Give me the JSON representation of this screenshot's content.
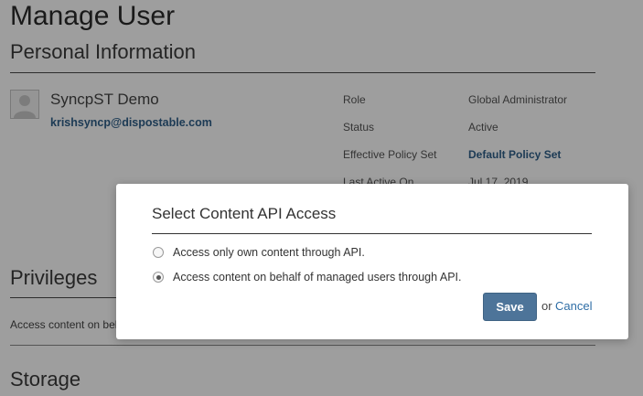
{
  "page": {
    "title": "Manage User"
  },
  "personal_info": {
    "heading": "Personal Information",
    "user_name": "SyncpST Demo",
    "user_email": "krishsyncp@dispostable.com",
    "fields": [
      {
        "label": "Role",
        "value": "Global Administrator"
      },
      {
        "label": "Status",
        "value": "Active"
      },
      {
        "label": "Effective Policy Set",
        "value": "Default Policy Set"
      },
      {
        "label": "Last Active On",
        "value": "Jul 17, 2019"
      }
    ]
  },
  "privileges": {
    "heading": "Privileges",
    "text": "Access content on behalf of managed users through API."
  },
  "storage": {
    "heading": "Storage"
  },
  "modal": {
    "title": "Select Content API Access",
    "options": [
      {
        "label": "Access only own content through API.",
        "checked": false
      },
      {
        "label": "Access content on behalf of managed users through API.",
        "checked": true
      }
    ],
    "save_label": "Save",
    "or_label": "or",
    "cancel_label": "Cancel"
  },
  "colors": {
    "accent": "#4d7499",
    "link": "#2f5f8a",
    "overlay": "rgba(0,0,0,0.38)"
  }
}
